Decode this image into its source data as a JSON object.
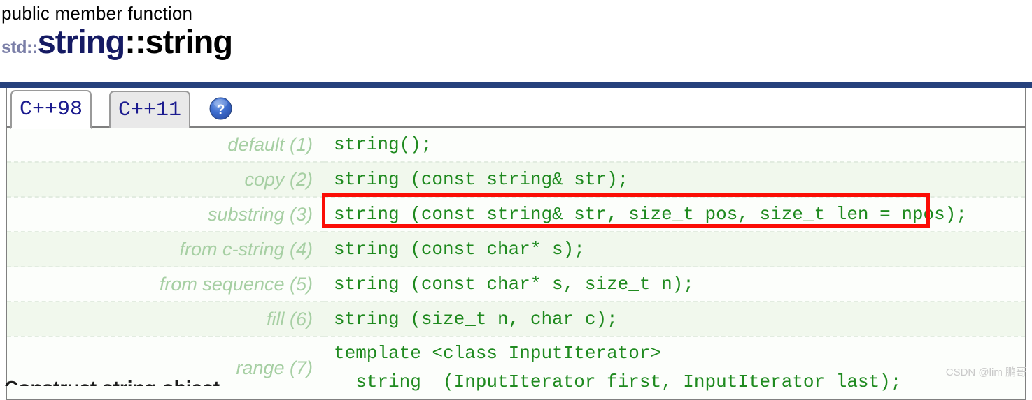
{
  "header": {
    "kind": "public member function",
    "namespace": "std::",
    "class_name": "string",
    "separator": "::",
    "member_name": "string"
  },
  "tabs": {
    "items": [
      {
        "label": "C++98",
        "active": true
      },
      {
        "label": "C++11",
        "active": false
      }
    ],
    "help_icon": "help-question-icon",
    "help_glyph": "?"
  },
  "constructors": {
    "rows": [
      {
        "label": "default (1)",
        "code": "string();",
        "highlighted": false
      },
      {
        "label": "copy (2)",
        "code": "string (const string& str);",
        "highlighted": false
      },
      {
        "label": "substring (3)",
        "code": "string (const string& str, size_t pos, size_t len = npos);",
        "highlighted": true
      },
      {
        "label": "from c-string (4)",
        "code": "string (const char* s);",
        "highlighted": false
      },
      {
        "label": "from sequence (5)",
        "code": "string (const char* s, size_t n);",
        "highlighted": false
      },
      {
        "label": "fill (6)",
        "code": "string (size_t n, char c);",
        "highlighted": false
      },
      {
        "label": "range (7)",
        "code": "template <class InputIterator>\n  string  (InputIterator first, InputIterator last);",
        "highlighted": false
      }
    ]
  },
  "section_heading": "Construct string object",
  "watermark": "CSDN @lim 鹏哥",
  "colors": {
    "navy_bar": "#26417c",
    "title_class": "#151a63",
    "title_namespace": "#7b7fa8",
    "code_green": "#1f8a1f",
    "label_green": "#a6cfa3",
    "highlight_red": "#fb0d05",
    "tab_text": "#1b1b8f",
    "row_even": "#f1f8ed",
    "row_odd": "#fcfefb"
  }
}
